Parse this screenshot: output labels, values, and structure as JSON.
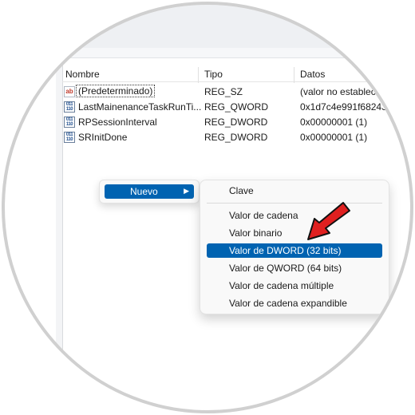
{
  "columns": {
    "name": "Nombre",
    "type": "Tipo",
    "data": "Datos"
  },
  "rows": [
    {
      "icon": "string-value-icon",
      "name": "(Predeterminado)",
      "type": "REG_SZ",
      "data": "(valor no establec"
    },
    {
      "icon": "binary-value-icon",
      "name": "LastMainenanceTaskRunTi...",
      "type": "REG_QWORD",
      "data": "0x1d7c4e991f68243"
    },
    {
      "icon": "binary-value-icon",
      "name": "RPSessionInterval",
      "type": "REG_DWORD",
      "data": "0x00000001 (1)"
    },
    {
      "icon": "binary-value-icon",
      "name": "SRInitDone",
      "type": "REG_DWORD",
      "data": "0x00000001 (1)"
    }
  ],
  "context_menu": {
    "new_label": "Nuevo",
    "submenu": [
      {
        "label": "Clave"
      },
      {
        "label": "Valor de cadena"
      },
      {
        "label": "Valor binario"
      },
      {
        "label": "Valor de DWORD (32 bits)"
      },
      {
        "label": "Valor de QWORD (64 bits)"
      },
      {
        "label": "Valor de cadena múltiple"
      },
      {
        "label": "Valor de cadena expandible"
      }
    ]
  },
  "colors": {
    "highlight": "#0063b1",
    "annotation_arrow": "#e02020"
  }
}
